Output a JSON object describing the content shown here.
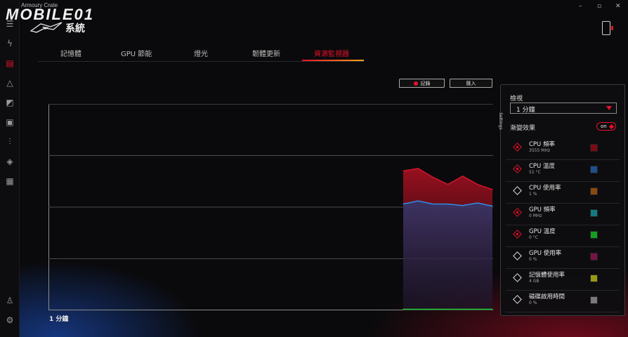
{
  "app": {
    "brand_small": "Armoury Crate",
    "watermark": "MOBILE01",
    "page_title": "系統"
  },
  "window_controls": {
    "minimize": "–",
    "maximize": "▫",
    "close": "✕"
  },
  "tabs": [
    {
      "label": "記憶體",
      "active": false
    },
    {
      "label": "GPU 節能",
      "active": false
    },
    {
      "label": "燈光",
      "active": false
    },
    {
      "label": "韌體更新",
      "active": false
    },
    {
      "label": "資源監視器",
      "active": true
    }
  ],
  "actions": {
    "record_label": "記錄",
    "import_label": "匯入"
  },
  "chart_data": {
    "type": "line",
    "xlabel": "1 分鐘",
    "ylim": [
      0,
      4
    ],
    "grid": true,
    "x": [
      0,
      1,
      2,
      3,
      4,
      5,
      6
    ],
    "series": [
      {
        "name": "CPU 頻率",
        "color": "#d4142e",
        "fill": true,
        "values": [
          2.7,
          2.75,
          2.58,
          2.44,
          2.6,
          2.44,
          2.34
        ]
      },
      {
        "name": "CPU 溫度",
        "color": "#2f8fe8",
        "fill": true,
        "values": [
          2.06,
          2.12,
          2.06,
          2.06,
          2.03,
          2.08,
          2.02
        ]
      },
      {
        "name": "GPU 溫度",
        "color": "#22cc33",
        "fill": false,
        "values": [
          0.02,
          0.02,
          0.02,
          0.02,
          0.02,
          0.02,
          0.02
        ]
      }
    ]
  },
  "settings_panel": {
    "tab_label": "Settings",
    "view_label": "檢視",
    "view_value": "1 分鐘",
    "fade_label": "漸變效果",
    "fade_toggle": "on",
    "metrics": [
      {
        "name": "CPU 頻率",
        "value": "3555 MHz",
        "enabled": true,
        "color": "#7a0a14"
      },
      {
        "name": "CPU 溫度",
        "value": "51 °C",
        "enabled": true,
        "color": "#1f4f8c"
      },
      {
        "name": "CPU 使用率",
        "value": "1 %",
        "enabled": false,
        "color": "#8a4a10"
      },
      {
        "name": "GPU 頻率",
        "value": "0 MHz",
        "enabled": true,
        "color": "#127a80"
      },
      {
        "name": "GPU 溫度",
        "value": "0 °C",
        "enabled": true,
        "color": "#13a020"
      },
      {
        "name": "GPU 使用率",
        "value": "0 %",
        "enabled": false,
        "color": "#7a1248"
      },
      {
        "name": "記憶體使用率",
        "value": "4 GB",
        "enabled": false,
        "color": "#9a9a12"
      },
      {
        "name": "磁碟啟用時間",
        "value": "0 %",
        "enabled": false,
        "color": "#7a7a7a"
      }
    ]
  },
  "icons": {
    "menu": "hamburger-icon",
    "rail": [
      "lightning-icon",
      "system-icon",
      "aura-icon",
      "gamevisual-icon",
      "gpu-icon",
      "sliders-icon",
      "tag-icon",
      "news-icon",
      "user-icon",
      "gear-icon"
    ]
  }
}
